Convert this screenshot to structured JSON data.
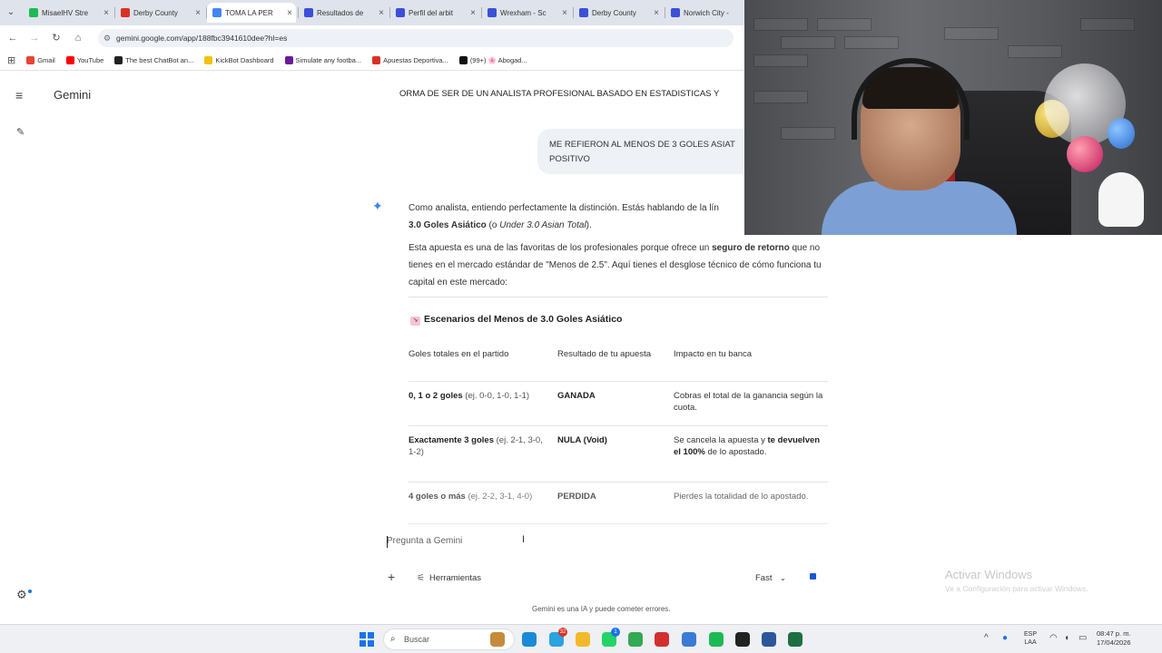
{
  "browser": {
    "tabs": [
      {
        "title": "MisaelHV Stre",
        "favicon_color": "#1db954"
      },
      {
        "title": "Derby County",
        "favicon_color": "#d93025"
      },
      {
        "title": "TOMA LA PER",
        "favicon_color": "#4285f4"
      },
      {
        "title": "Resultados de",
        "favicon_color": "#3c4fd9"
      },
      {
        "title": "Perfil del arbit",
        "favicon_color": "#3c4fd9"
      },
      {
        "title": "Wrexham - Sc",
        "favicon_color": "#3c4fd9"
      },
      {
        "title": "Derby County",
        "favicon_color": "#3c4fd9"
      },
      {
        "title": "Norwich City -",
        "favicon_color": "#3c4fd9"
      }
    ],
    "active_tab_index": 2,
    "url": "gemini.google.com/app/188fbc3941610dee?hl=es",
    "bookmarks": [
      {
        "label": "Gmail",
        "color": "#ea4335"
      },
      {
        "label": "YouTube",
        "color": "#ff0000"
      },
      {
        "label": "The best ChatBot an...",
        "color": "#222222"
      },
      {
        "label": "KickBot Dashboard",
        "color": "#f4c20d"
      },
      {
        "label": "Simulate any footba...",
        "color": "#6a1b9a"
      },
      {
        "label": "Apuestas Deportiva...",
        "color": "#d93025"
      },
      {
        "label": "(99+) 🌸 Abogad...",
        "color": "#111111"
      }
    ]
  },
  "gemini": {
    "app_title": "Gemini",
    "prompt_line": "ORMA DE SER DE UN ANALISTA PROFESIONAL BASADO EN ESTADISTICAS Y",
    "user_message": "ME REFIERON AL MENOS DE 3 GOLES ASIAT POSITIVO",
    "user_message_line1": "ME REFIERON AL MENOS DE 3 GOLES ASIAT",
    "user_message_line2": "POSITIVO",
    "resp1": {
      "a": "Como analista, entiendo perfectamente la distinción. Estás hablando de la lín",
      "b": "3.0 Goles Asiático",
      "c": " (o ",
      "d": "Under 3.0 Asian Total",
      "e": ")."
    },
    "resp2": {
      "a": "Esta apuesta es una de las favoritas de los profesionales porque ofrece un ",
      "b": "seguro de retorno",
      "c": " que no tienes en el mercado estándar de \"Menos de 2.5\". Aquí tienes el desglose técnico de cómo funciona tu capital en este mercado:"
    },
    "section_title": "Escenarios del Menos de 3.0 Goles Asiático",
    "table": {
      "headers": [
        "Goles totales en el partido",
        "Resultado de tu apuesta",
        "Impacto en tu banca"
      ],
      "rows": [
        {
          "goals_b": "0, 1 o 2 goles",
          "goals_ex": " (ej. 0-0, 1-0, 1-1)",
          "result": "GANADA",
          "impact_a": "Cobras el total de la ganancia según la cuota.",
          "impact_b": "",
          "impact_c": ""
        },
        {
          "goals_b": "Exactamente 3 goles",
          "goals_ex": " (ej. 2-1, 3-0, 1-2)",
          "result": "NULA (Void)",
          "impact_a": "Se cancela la apuesta y ",
          "impact_b": "te devuelven el 100%",
          "impact_c": " de lo apostado."
        },
        {
          "goals_b": "4 goles o más",
          "goals_ex": " (ej. 2-2, 3-1, 4-0)",
          "result": "PERDIDA",
          "impact_a": "Pierdes la totalidad de lo apostado.",
          "impact_b": "",
          "impact_c": ""
        }
      ]
    },
    "input_placeholder": "Pregunta a Gemini",
    "tools_label": "Herramientas",
    "model_label": "Fast",
    "disclaimer": "Gemini es una IA y puede cometer errores."
  },
  "windows_watermark": {
    "title": "Activar Windows",
    "subtitle": "Ve a Configuración para activar Windows."
  },
  "taskbar": {
    "search_placeholder": "Buscar",
    "apps": [
      {
        "name": "widgets",
        "color": "#c58b3a"
      },
      {
        "name": "edge",
        "color": "#1b8ad6"
      },
      {
        "name": "telegram",
        "color": "#2aa3df",
        "badge": "32"
      },
      {
        "name": "explorer",
        "color": "#f2b92a"
      },
      {
        "name": "whatsapp",
        "color": "#25d366",
        "badge": "1"
      },
      {
        "name": "chrome",
        "color": "#34a853"
      },
      {
        "name": "typora",
        "color": "#d32f2f"
      },
      {
        "name": "calculator",
        "color": "#3a7bd5"
      },
      {
        "name": "spotify",
        "color": "#1db954"
      },
      {
        "name": "capcut",
        "color": "#222222"
      },
      {
        "name": "word",
        "color": "#2b579a"
      },
      {
        "name": "excel",
        "color": "#1d6f42"
      }
    ],
    "language_line1": "ESP",
    "language_line2": "LAA",
    "time": "08:47 p. m.",
    "date": "17/04/2026"
  }
}
